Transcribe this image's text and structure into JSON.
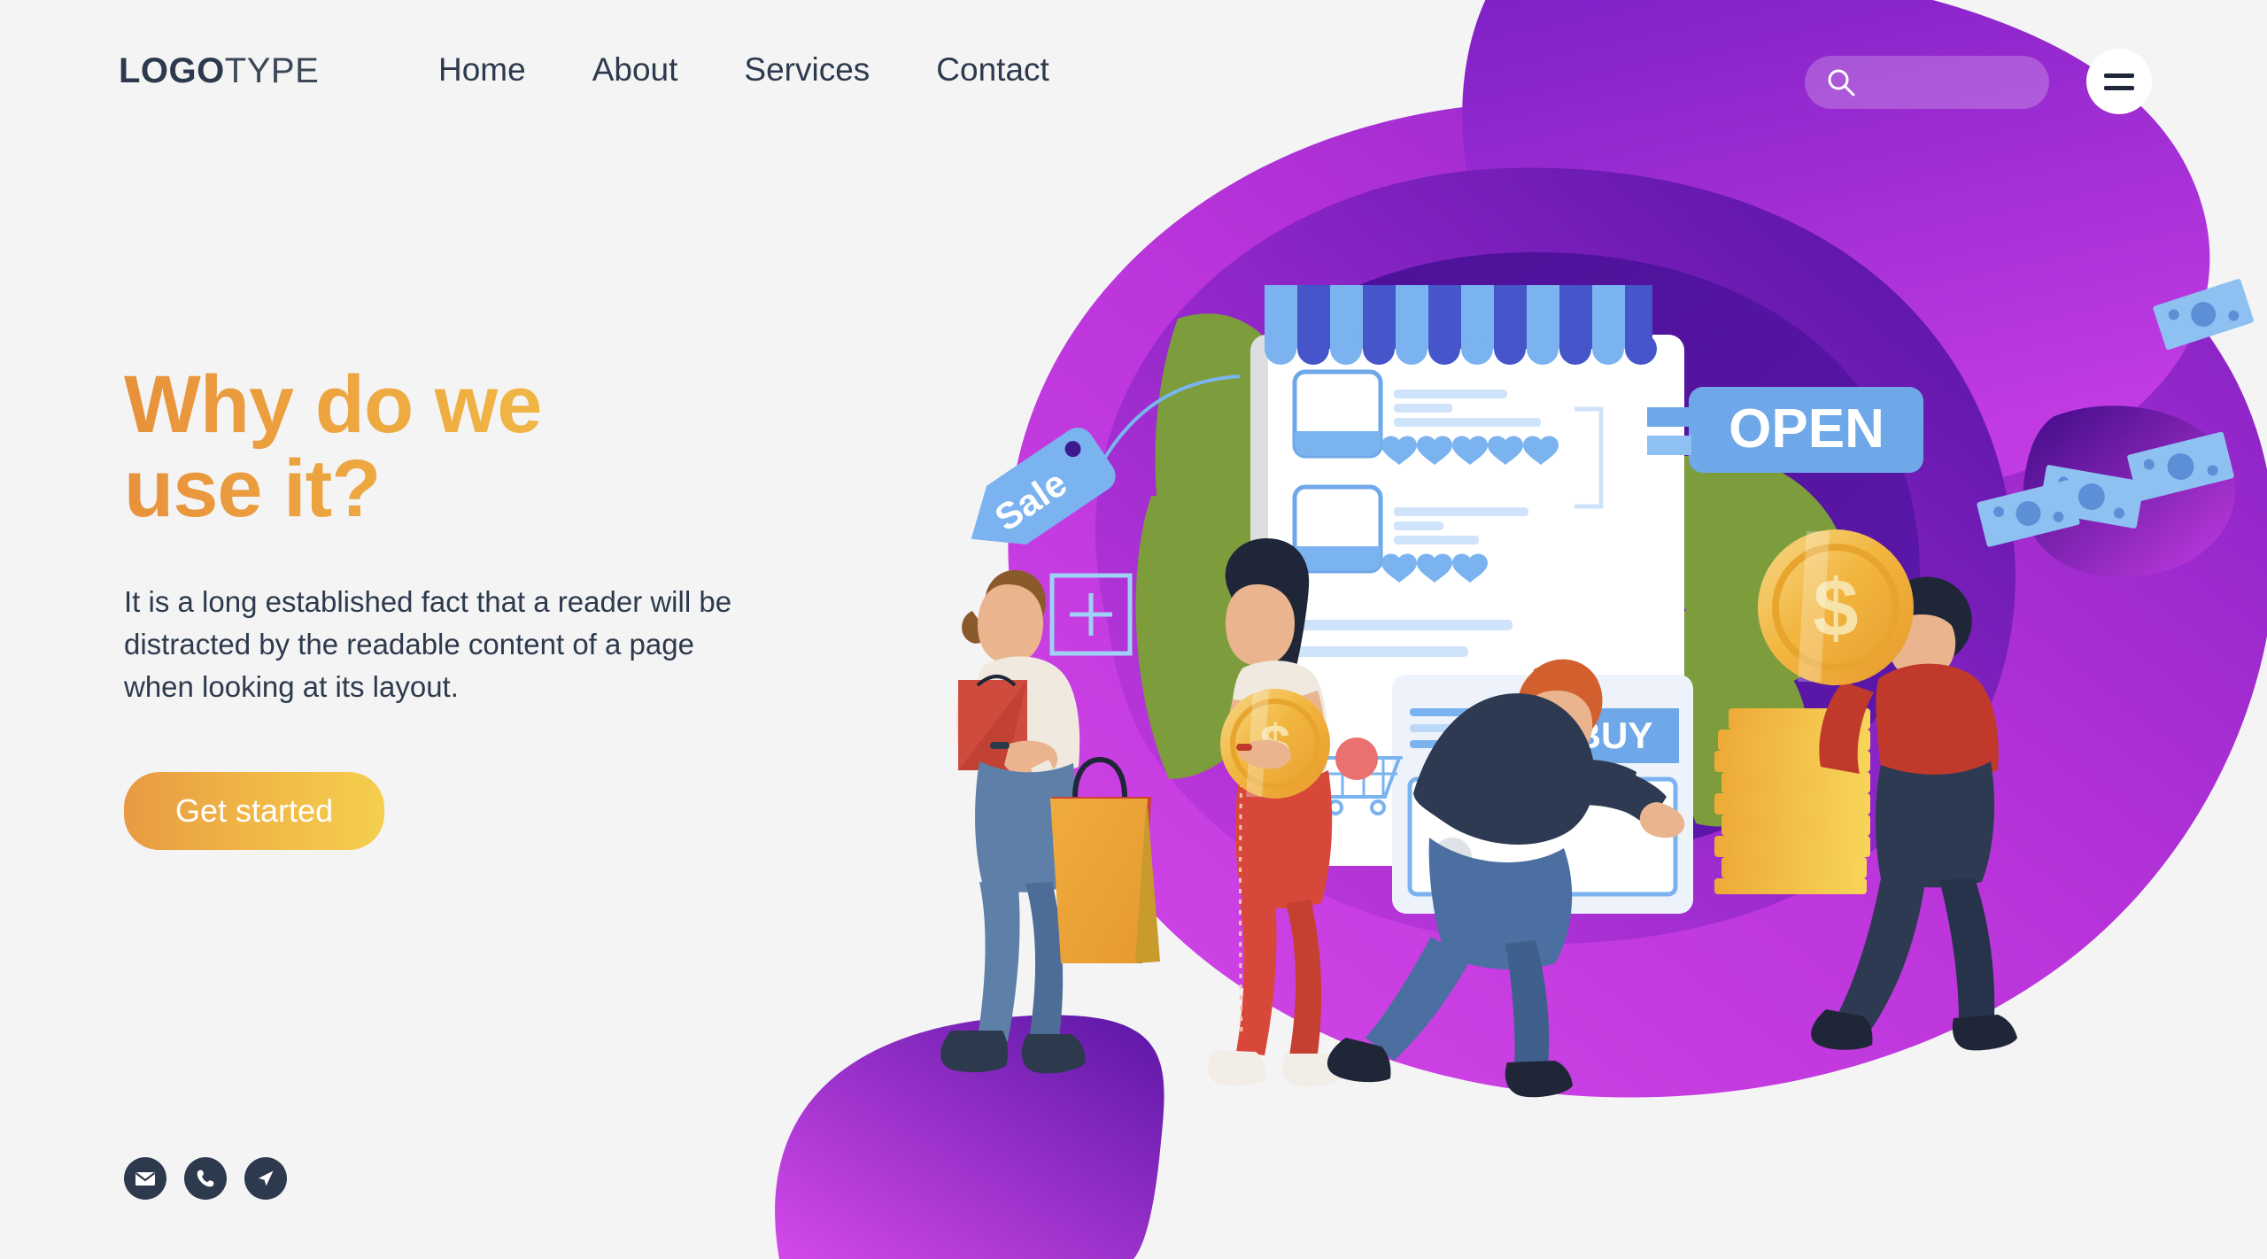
{
  "brand": {
    "bold_part": "LOGO",
    "light_part": "TYPE"
  },
  "nav": {
    "items": [
      {
        "label": "Home"
      },
      {
        "label": "About"
      },
      {
        "label": "Services"
      },
      {
        "label": "Contact"
      }
    ]
  },
  "search": {
    "value": "",
    "placeholder": "",
    "icon": "search-icon"
  },
  "menu_button": {
    "icon": "hamburger-menu-icon"
  },
  "hero": {
    "heading_line1": "Why do we",
    "heading_line2": "use it?",
    "paragraph": "It is a long established fact that a reader will be distracted by the readable content of a page when looking at its layout.",
    "cta_label": "Get started"
  },
  "socials": [
    {
      "name": "email-icon",
      "label": "Email"
    },
    {
      "name": "phone-icon",
      "label": "Phone"
    },
    {
      "name": "send-icon",
      "label": "Send"
    }
  ],
  "illustration": {
    "sale_tag": "Sale",
    "open_sign": "OPEN",
    "buy_button": "BUY",
    "coin_symbol": "$",
    "product_rows": [
      {
        "hearts": 5
      },
      {
        "hearts": 3
      }
    ]
  },
  "colors": {
    "page_bg": "#f4f4f5",
    "text_dark": "#2d3a4d",
    "accent_orange": "#e8913c",
    "accent_yellow": "#f4cb4c",
    "blob_magenta": "#c03be0",
    "blob_purple": "#5b1ba8",
    "blob_deep": "#4a119a",
    "sign_blue": "#6ea8e8",
    "leaf_green": "#7d9c3c",
    "coin_gold": "#f0b53f"
  }
}
